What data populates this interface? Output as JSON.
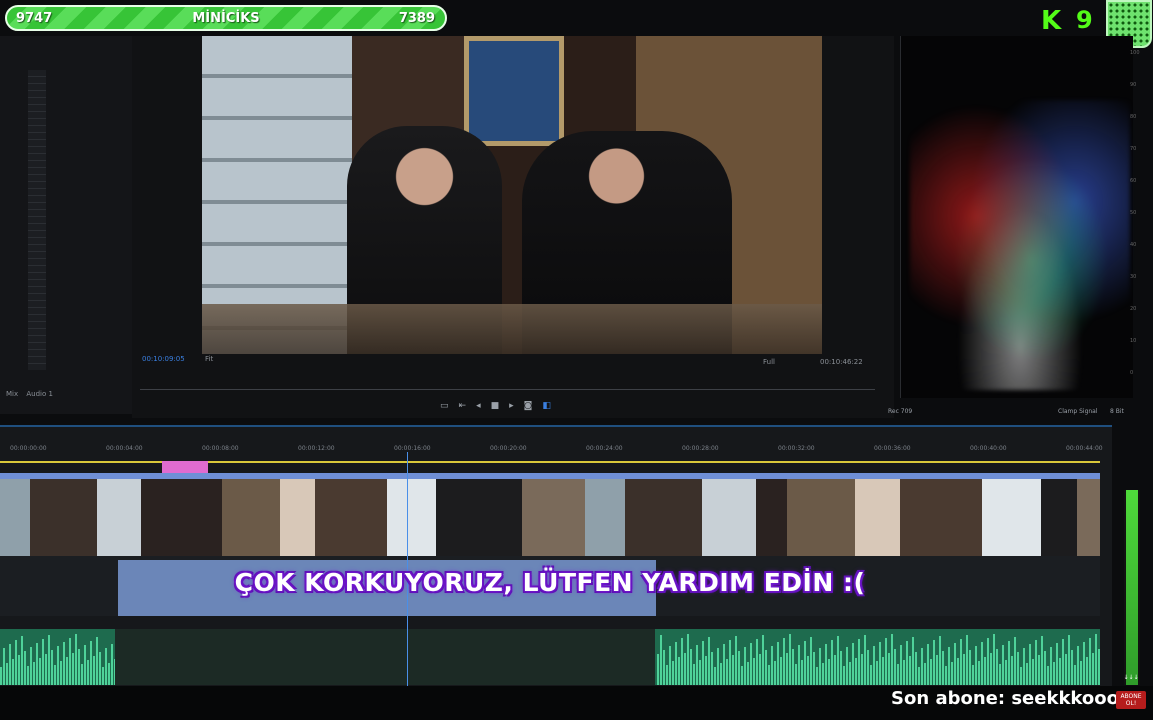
{
  "overlay": {
    "progress": {
      "left_value": "9747",
      "title": "MİNİCİKS",
      "right_value": "7389",
      "color": "#37c437"
    },
    "kick_logo": "K",
    "viewer_count": "9",
    "subtitle": "ÇOK KORKUYORUZ, LÜTFEN YARDIM EDİN :(",
    "latest_subscriber": "Son abone: seekkkooo",
    "abone_badge": [
      "↓↓↓",
      "ABONE",
      "OL!"
    ]
  },
  "editor": {
    "left_panel_tabs": [
      "Mix",
      "Audio 1"
    ],
    "program_monitor": {
      "timecode_left": "00:10:09:05",
      "fit_label": "Fit",
      "quality_label": "Full",
      "timecode_right": "00:10:46:22",
      "transport_icons": [
        "safe-margins-icon",
        "mark-in-icon",
        "step-back-icon",
        "stop-icon",
        "step-forward-icon",
        "camera-icon",
        "export-icon"
      ]
    },
    "scopes": {
      "tick_labels": [
        "100",
        "90",
        "80",
        "70",
        "60",
        "50",
        "40",
        "30",
        "20",
        "10",
        "0"
      ],
      "footer_left": "Rec 709",
      "footer_mid": "Clamp Signal",
      "footer_right": "8 Bit"
    },
    "timeline": {
      "ruler": [
        "00:00:00:00",
        "00:00:04:00",
        "00:00:08:00",
        "00:00:12:00",
        "00:00:16:00",
        "00:00:20:00",
        "00:00:24:00",
        "00:00:28:00",
        "00:00:32:00",
        "00:00:36:00",
        "00:00:40:00",
        "00:00:44:00"
      ],
      "accent_color": "#4a8fe8"
    }
  }
}
